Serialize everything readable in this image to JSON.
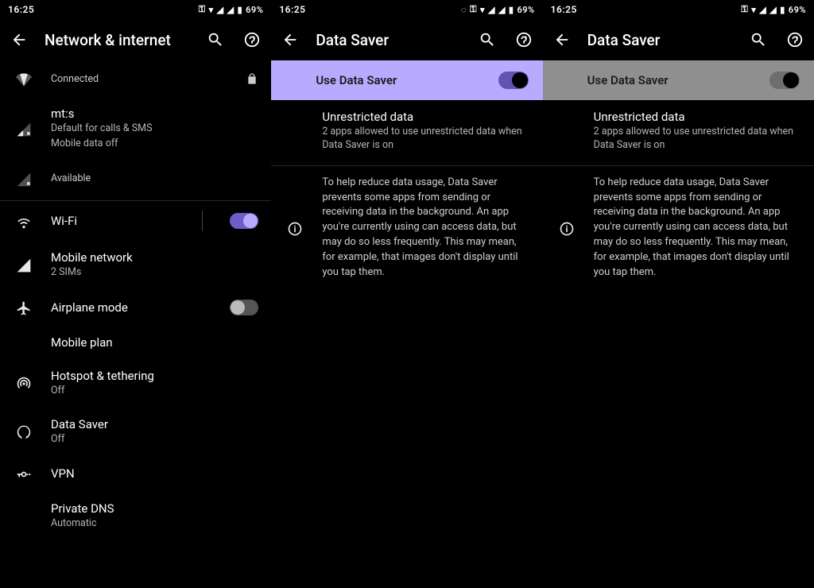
{
  "status": {
    "time": "16:25",
    "battery": "69%"
  },
  "pane1": {
    "title": "Network & internet",
    "wifi_connected": "Connected",
    "sim1_name": "mt:s",
    "sim1_line1": "Default for calls & SMS",
    "sim1_line2": "Mobile data off",
    "sim2_status": "Available",
    "wifi_label": "Wi-Fi",
    "mobile_net": "Mobile network",
    "mobile_net_sub": "2 SIMs",
    "airplane": "Airplane mode",
    "mobile_plan": "Mobile plan",
    "hotspot": "Hotspot & tethering",
    "hotspot_sub": "Off",
    "datasaver": "Data Saver",
    "datasaver_sub": "Off",
    "vpn": "VPN",
    "private_dns": "Private DNS",
    "private_dns_sub": "Automatic"
  },
  "pane2": {
    "title": "Data Saver",
    "use_label": "Use Data Saver",
    "unrestricted_title": "Unrestricted data",
    "unrestricted_sub": "2 apps allowed to use unrestricted data when Data Saver is on",
    "info": "To help reduce data usage, Data Saver prevents some apps from sending or receiving data in the background. An app you're currently using can access data, but may do so less frequently. This may mean, for example, that images don't display until you tap them."
  },
  "pane3": {
    "title": "Data Saver",
    "use_label": "Use Data Saver",
    "unrestricted_title": "Unrestricted data",
    "unrestricted_sub": "2 apps allowed to use unrestricted data when Data Saver is on",
    "info": "To help reduce data usage, Data Saver prevents some apps from sending or receiving data in the background. An app you're currently using can access data, but may do so less frequently. This may mean, for example, that images don't display until you tap them."
  }
}
